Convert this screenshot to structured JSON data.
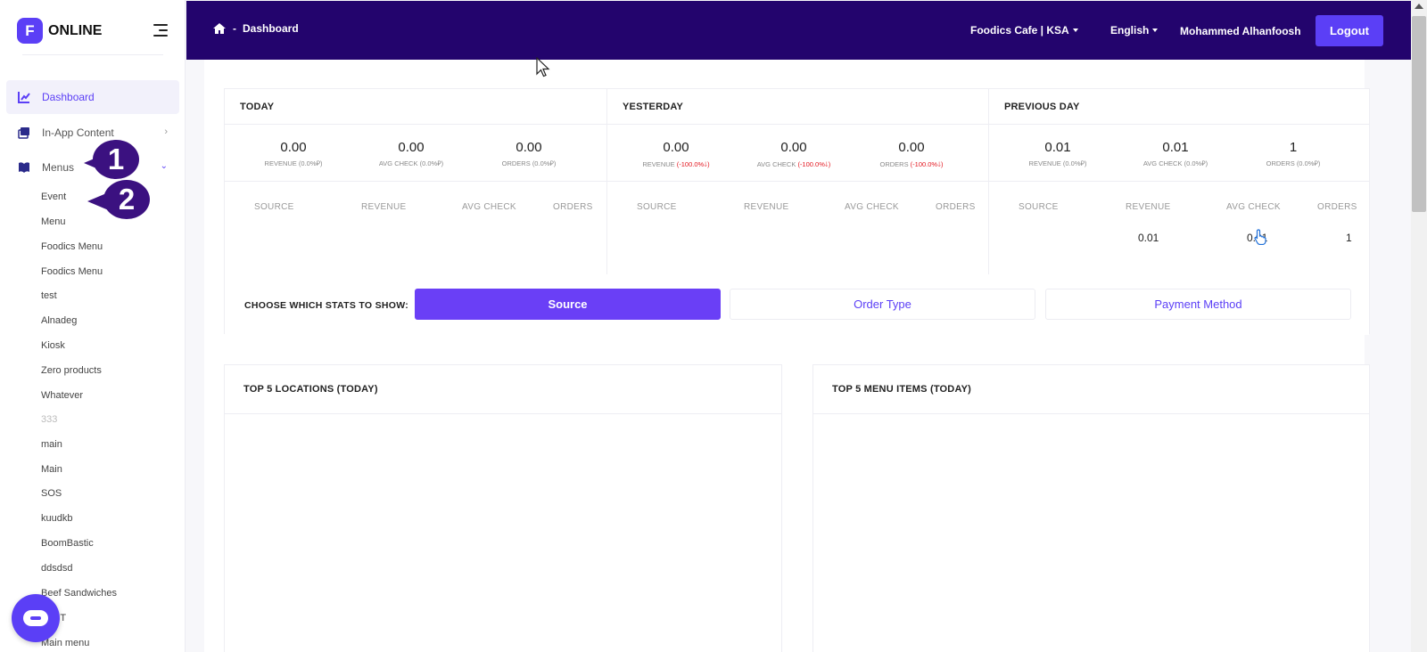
{
  "sidebar": {
    "brand": "ONLINE",
    "logo_letter": "F",
    "nav": [
      {
        "label": "Dashboard",
        "icon": "chart-icon",
        "active": true
      },
      {
        "label": "In-App Content",
        "icon": "images-icon"
      },
      {
        "label": "Menus",
        "icon": "book-icon",
        "expanded": true
      }
    ],
    "menus": [
      "Event",
      "Menu",
      "Foodics Menu",
      "Foodics Menu",
      "test",
      "Alnadeg",
      "Kiosk",
      "Zero products",
      "Whatever",
      "333",
      "main",
      "Main",
      "SOS",
      "kuudkb",
      "BoomBastic",
      "ddsdsd",
      "Beef Sandwiches",
      "TEST",
      "Main menu"
    ],
    "callouts": [
      "1",
      "2"
    ]
  },
  "header": {
    "breadcrumb_sep": "-",
    "breadcrumb": "Dashboard",
    "branch": "Foodics Cafe | KSA",
    "language": "English",
    "user": "Mohammed Alhanfoosh",
    "logout": "Logout"
  },
  "stats": {
    "periods": [
      {
        "title": "TODAY",
        "metrics": [
          {
            "value": "0.00",
            "label": "REVENUE",
            "change": "(0.0%⃁)"
          },
          {
            "value": "0.00",
            "label": "AVG CHECK",
            "change": "(0.0%⃁)"
          },
          {
            "value": "0.00",
            "label": "ORDERS",
            "change": "(0.0%⃁)"
          }
        ]
      },
      {
        "title": "YESTERDAY",
        "metrics": [
          {
            "value": "0.00",
            "label": "REVENUE",
            "change": "(-100.0%🡓)"
          },
          {
            "value": "0.00",
            "label": "AVG CHECK",
            "change": "(-100.0%🡓)"
          },
          {
            "value": "0.00",
            "label": "ORDERS",
            "change": "(-100.0%🡓)"
          }
        ]
      },
      {
        "title": "PREVIOUS DAY",
        "metrics": [
          {
            "value": "0.01",
            "label": "REVENUE",
            "change": "(0.0%⃁)"
          },
          {
            "value": "0.01",
            "label": "AVG CHECK",
            "change": "(0.0%⃁)"
          },
          {
            "value": "1",
            "label": "ORDERS",
            "change": "(0.0%⃁)"
          }
        ]
      }
    ],
    "table_headers": [
      "SOURCE",
      "REVENUE",
      "AVG CHECK",
      "ORDERS"
    ],
    "previous_day_row": {
      "revenue": "0.01",
      "avg_check": "0.01",
      "orders": "1"
    },
    "choose_label": "CHOOSE WHICH STATS TO SHOW:",
    "options": [
      "Source",
      "Order Type",
      "Payment Method"
    ],
    "selected_option": "Source"
  },
  "panels": {
    "locations_title": "TOP 5 LOCATIONS (TODAY)",
    "menu_items_title": "TOP 5 MENU ITEMS (TODAY)"
  },
  "colors": {
    "accent": "#5b3ff6",
    "topbar": "#23046d",
    "negative": "#e3161f",
    "callout": "#3b1180"
  }
}
